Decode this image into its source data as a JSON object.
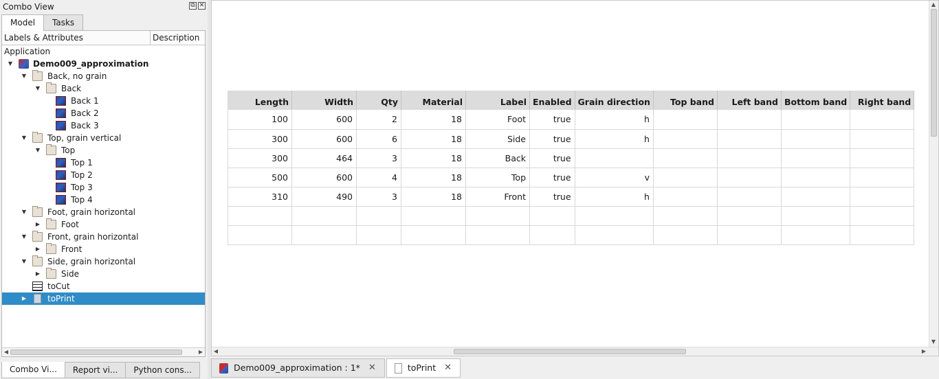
{
  "left_panel": {
    "title": "Combo View",
    "tabs": [
      "Model",
      "Tasks"
    ],
    "tree_headers": [
      "Labels & Attributes",
      "Description"
    ],
    "root_label": "Application",
    "tree": [
      {
        "label": "Demo009_approximation",
        "icon": "document-icon",
        "depth": 0,
        "arrow": "expanded",
        "bold": true
      },
      {
        "label": "Back, no grain",
        "icon": "folder-icon",
        "depth": 1,
        "arrow": "expanded"
      },
      {
        "label": "Back",
        "icon": "folder-icon",
        "depth": 2,
        "arrow": "expanded"
      },
      {
        "label": "Back 1",
        "icon": "cube-icon",
        "depth": 3,
        "arrow": ""
      },
      {
        "label": "Back 2",
        "icon": "cube-icon",
        "depth": 3,
        "arrow": ""
      },
      {
        "label": "Back 3",
        "icon": "cube-icon",
        "depth": 3,
        "arrow": ""
      },
      {
        "label": "Top, grain vertical",
        "icon": "folder-icon",
        "depth": 1,
        "arrow": "expanded"
      },
      {
        "label": "Top",
        "icon": "folder-icon",
        "depth": 2,
        "arrow": "expanded"
      },
      {
        "label": "Top 1",
        "icon": "cube-icon",
        "depth": 3,
        "arrow": ""
      },
      {
        "label": "Top 2",
        "icon": "cube-icon",
        "depth": 3,
        "arrow": ""
      },
      {
        "label": "Top 3",
        "icon": "cube-icon",
        "depth": 3,
        "arrow": ""
      },
      {
        "label": "Top 4",
        "icon": "cube-icon",
        "depth": 3,
        "arrow": ""
      },
      {
        "label": "Foot, grain horizontal",
        "icon": "folder-icon",
        "depth": 1,
        "arrow": "expanded"
      },
      {
        "label": "Foot",
        "icon": "folder-icon",
        "depth": 2,
        "arrow": "collapsed"
      },
      {
        "label": "Front, grain horizontal",
        "icon": "folder-icon",
        "depth": 1,
        "arrow": "expanded"
      },
      {
        "label": "Front",
        "icon": "folder-icon",
        "depth": 2,
        "arrow": "collapsed"
      },
      {
        "label": "Side, grain horizontal",
        "icon": "folder-icon",
        "depth": 1,
        "arrow": "expanded"
      },
      {
        "label": "Side",
        "icon": "folder-icon",
        "depth": 2,
        "arrow": "collapsed"
      },
      {
        "label": "toCut",
        "icon": "spreadsheet-icon",
        "depth": 1,
        "arrow": ""
      },
      {
        "label": "toPrint",
        "icon": "page-icon",
        "depth": 1,
        "arrow": "collapsed",
        "selected": true
      }
    ],
    "bottom_tabs": [
      "Combo Vi...",
      "Report vi...",
      "Python cons..."
    ]
  },
  "spreadsheet": {
    "headers": [
      "Length",
      "Width",
      "Qty",
      "Material",
      "Label",
      "Enabled",
      "Grain direction",
      "Top band",
      "Left band",
      "Bottom band",
      "Right band"
    ],
    "rows": [
      [
        "100",
        "600",
        "2",
        "18",
        "Foot",
        "true",
        "h",
        "",
        "",
        "",
        ""
      ],
      [
        "300",
        "600",
        "6",
        "18",
        "Side",
        "true",
        "h",
        "",
        "",
        "",
        ""
      ],
      [
        "300",
        "464",
        "3",
        "18",
        "Back",
        "true",
        "",
        "",
        "",
        "",
        ""
      ],
      [
        "500",
        "600",
        "4",
        "18",
        "Top",
        "true",
        "v",
        "",
        "",
        "",
        ""
      ],
      [
        "310",
        "490",
        "3",
        "18",
        "Front",
        "true",
        "h",
        "",
        "",
        "",
        ""
      ],
      [
        "",
        "",
        "",
        "",
        "",
        "",
        "",
        "",
        "",
        "",
        ""
      ],
      [
        "",
        "",
        "",
        "",
        "",
        "",
        "",
        "",
        "",
        "",
        ""
      ]
    ]
  },
  "document_tabs": [
    {
      "label": "Demo009_approximation : 1*",
      "icon": "freecad-document-icon",
      "active": false
    },
    {
      "label": "toPrint",
      "icon": "page-icon",
      "active": true
    }
  ],
  "colors": {
    "selection": "#308cc6",
    "header_bg": "#dcdcdc"
  }
}
